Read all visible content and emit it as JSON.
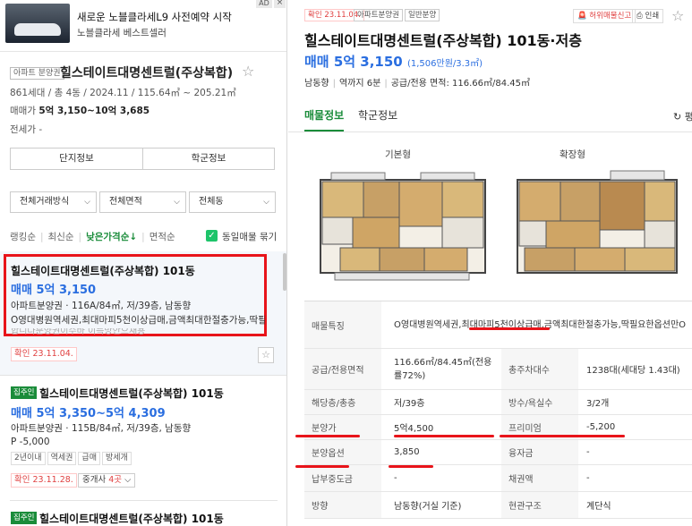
{
  "ad": {
    "title": "새로운 노블클라세L9 사전예약 시작",
    "subtitle": "노블클라세 베스트셀러",
    "badge": "AD",
    "close": "×"
  },
  "complex": {
    "type_tag": "아파트 분양권",
    "name": "힐스테이트대명센트럴(주상복합)",
    "meta": "861세대 / 총 4동 / 2024.11 / 115.64㎡ ~ 205.21㎡",
    "sale_label": "매매가",
    "sale_value": "5억 3,150~10억 3,685",
    "lease": "전세가 -",
    "btn_complex": "단지정보",
    "btn_school": "학군정보"
  },
  "filters": {
    "trade": "전체거래방식",
    "area": "전체면적",
    "dong": "전체동"
  },
  "sort": {
    "ranking": "랭킹순",
    "latest": "최신순",
    "low_price": "낮은가격순↓",
    "area": "면적순",
    "same_listing": "동일매물 묶기"
  },
  "listings": [
    {
      "title": "힐스테이트대명센트럴(주상복합) 101동",
      "price": "매매 5억 3,150",
      "info": "아파트분양권 · 116A/84㎡, 저/39층, 남동향",
      "desc": "O영대병원역세권,최대마피5천이상급매,금액최대한절충가능,딱필..",
      "desc2": "합니다분양권이수바 이득방안으재용",
      "confirm": "확인 23.11.04."
    },
    {
      "owner": "집주인",
      "title": "힐스테이트대명센트럴(주상복합) 101동",
      "price": "매매 5억 3,350~5억 4,309",
      "info": "아파트분양권 · 115B/84㎡, 저/39층, 남동향",
      "premium": "P -5,000",
      "tags": [
        "2년이내",
        "역세권",
        "급매",
        "방세개"
      ],
      "confirm": "확인 23.11.28.",
      "agent_prefix": "중개사 ",
      "agent_count": "4곳",
      "agent_suffix": " ⌵"
    },
    {
      "owner": "집주인",
      "title": "힐스테이트대명센트럴(주상복합) 101동"
    }
  ],
  "detail": {
    "confirm": "확인 23.11.04.",
    "type": "아파트분양권",
    "kind": "일반분양",
    "report": "허위매물신고",
    "print": "인쇄",
    "title": "힐스테이트대명센트럴(주상복합) 101동·저층",
    "price": "매매 5억 3,150",
    "price_per": "(1,506만원/3.3㎡)",
    "meta": [
      "남동향",
      "역까지 6분",
      "공급/전용 면적: 116.66㎡/84.45㎡"
    ],
    "tab_info": "매물정보",
    "tab_school": "학군정보",
    "refresh": "↻ 평",
    "fp_basic": "기본형",
    "fp_ext": "확장형"
  },
  "table": {
    "feature_label": "매물특징",
    "feature_value": "O영대병원역세권,최대마피5천이상급매,금액최대한절충가능,딱필요한옵션만O",
    "rows": [
      {
        "l1": "공급/전용면적",
        "v1": "116.66㎡/84.45㎡(전용률72%)",
        "l2": "총주차대수",
        "v2": "1238대(세대당 1.43대)"
      },
      {
        "l1": "해당층/총층",
        "v1": "저/39층",
        "l2": "방수/욕실수",
        "v2": "3/2개"
      },
      {
        "l1": "분양가",
        "v1": "5억4,500",
        "l2": "프리미엄",
        "v2": "-5,200"
      },
      {
        "l1": "분양옵션",
        "v1": "3,850",
        "l2": "융자금",
        "v2": "-"
      },
      {
        "l1": "납부중도금",
        "v1": "-",
        "l2": "채권액",
        "v2": "-"
      },
      {
        "l1": "방향",
        "v1": "남동향(거실 기준)",
        "l2": "현관구조",
        "v2": "계단식"
      }
    ]
  },
  "colors": {
    "accent_green": "#1a8c3a",
    "price_blue": "#2a6ee0",
    "annotation_red": "#e8141a"
  }
}
